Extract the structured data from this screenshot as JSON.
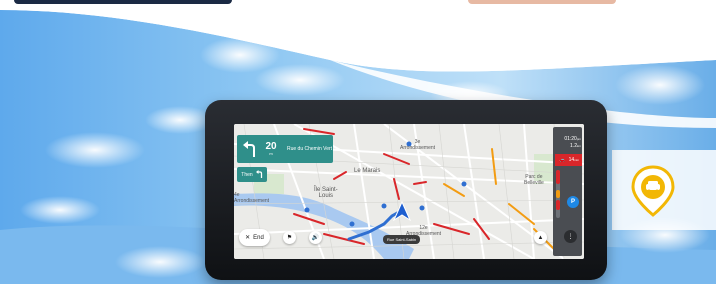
{
  "navigation": {
    "turn_distance_value": "20",
    "turn_distance_unit": "m",
    "turn_street": "Rue du Chemin Vert",
    "then_label": "Then",
    "current_street": "Rue Saint-Sabin"
  },
  "map_labels": {
    "district_top": "3e\nArrondissement",
    "le_marais": "Le Marais",
    "ile_saint_louis": "Île Saint-\nLouis",
    "arrondissement_left": "4e\nArrondissement",
    "arrondissement_bottom": "12e\nArrondissement",
    "parc_belleville": "Parc de\nBelleville"
  },
  "controls": {
    "end_label": "End"
  },
  "side_panel": {
    "time": "01:20",
    "time_unit": "pm",
    "distance": "1.2",
    "distance_unit": "km",
    "traffic_delay": "14",
    "traffic_unit": "min",
    "parking_label": "P"
  },
  "colors": {
    "nav_teal": "#2f8f8a",
    "traffic_red": "#d9262a",
    "traffic_orange": "#f39c12",
    "route_blue": "#2f6fd1",
    "pin_yellow": "#f2b705"
  },
  "icons": [
    "turn-left-icon",
    "turn-left-small-icon",
    "close-icon",
    "report-icon",
    "volume-icon",
    "direction-arrow-icon",
    "compass-icon",
    "more-icon",
    "car-pin-icon",
    "traffic-car-icon"
  ]
}
